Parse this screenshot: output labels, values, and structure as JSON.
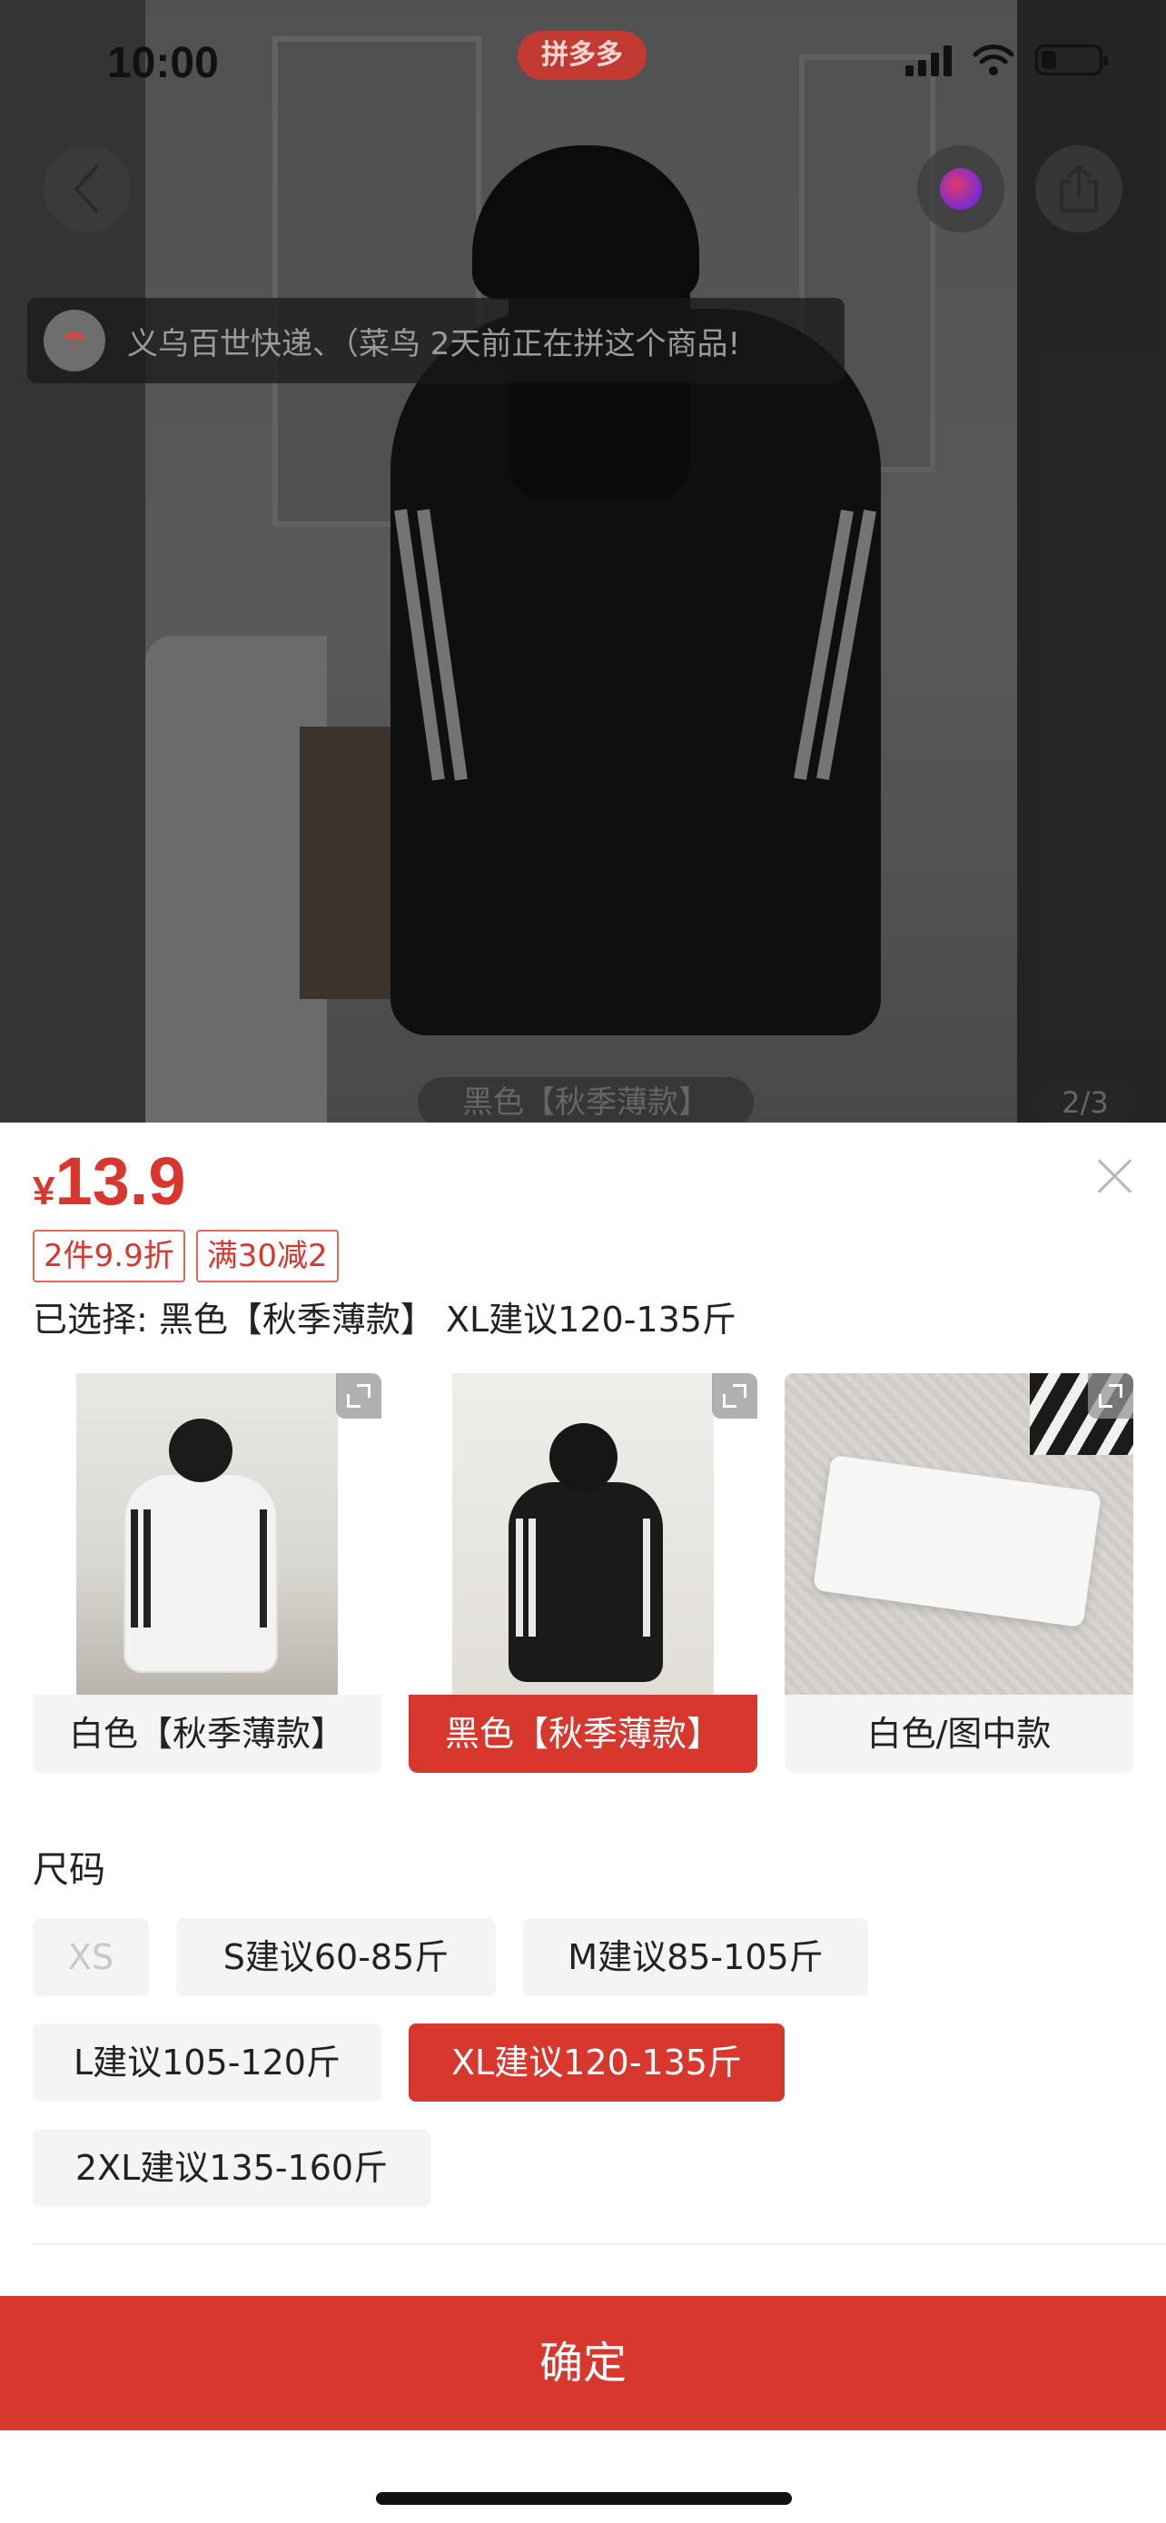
{
  "status_bar": {
    "time": "10:00",
    "app_badge": "拼多多"
  },
  "hero": {
    "notice_text": "义乌百世快递、（菜鸟 2天前正在拼这个商品!",
    "caption": "黑色【秋季薄款】",
    "page_indicator": "2/3"
  },
  "sheet": {
    "price_currency": "¥",
    "price_value": "13.9",
    "tags": [
      "2件9.9折",
      "满30减2"
    ],
    "selected_info": "已选择: 黑色【秋季薄款】 XL建议120-135斤",
    "colors": [
      {
        "label": "白色【秋季薄款】",
        "selected": false
      },
      {
        "label": "黑色【秋季薄款】",
        "selected": true
      },
      {
        "label": "白色/图中款",
        "selected": false
      }
    ],
    "size_title": "尺码",
    "sizes": [
      {
        "label": "XS",
        "state": "disabled"
      },
      {
        "label": "S建议60-85斤",
        "state": "normal"
      },
      {
        "label": "M建议85-105斤",
        "state": "normal"
      },
      {
        "label": "L建议105-120斤",
        "state": "normal"
      },
      {
        "label": "XL建议120-135斤",
        "state": "selected"
      },
      {
        "label": "2XL建议135-160斤",
        "state": "normal"
      }
    ],
    "confirm_label": "确定"
  },
  "colors": {
    "accent": "#d8372d",
    "chip_bg": "#f4f4f4"
  }
}
